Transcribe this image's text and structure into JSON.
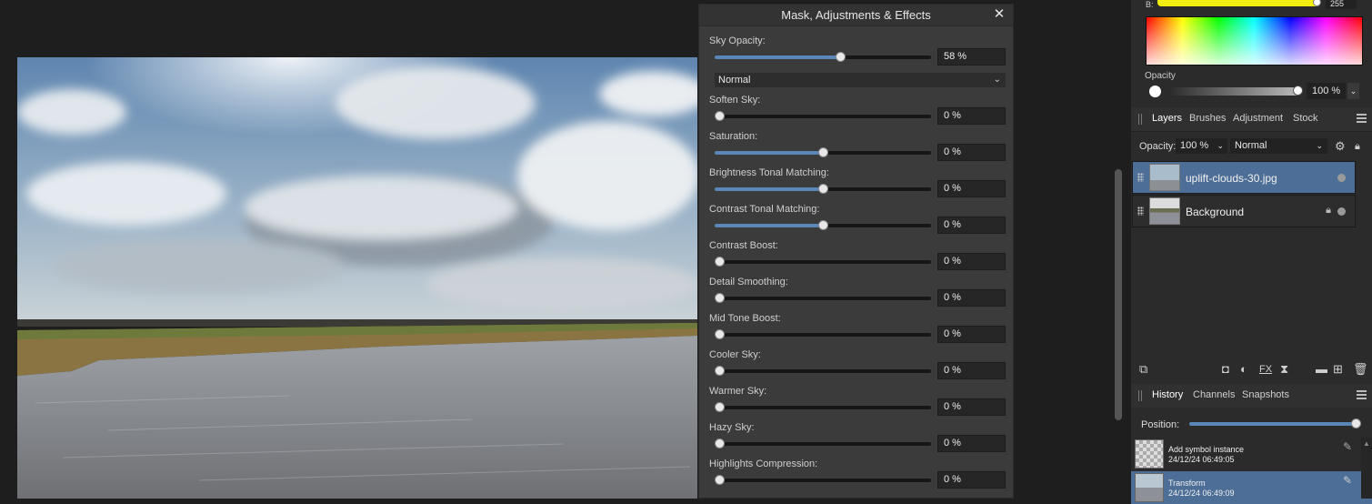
{
  "dialog": {
    "title": "Mask, Adjustments & Effects",
    "blend_mode": "Normal",
    "controls": [
      {
        "label": "Sky Opacity:",
        "value": "58 %",
        "fraction": 0.58
      },
      {
        "label": "Soften Sky:",
        "value": "0 %",
        "fraction": 0.0
      },
      {
        "label": "Saturation:",
        "value": "0 %",
        "fraction": 0.5
      },
      {
        "label": "Brightness Tonal Matching:",
        "value": "0 %",
        "fraction": 0.5
      },
      {
        "label": "Contrast Tonal Matching:",
        "value": "0 %",
        "fraction": 0.5
      },
      {
        "label": "Contrast Boost:",
        "value": "0 %",
        "fraction": 0.0
      },
      {
        "label": "Detail Smoothing:",
        "value": "0 %",
        "fraction": 0.0
      },
      {
        "label": "Mid Tone Boost:",
        "value": "0 %",
        "fraction": 0.0
      },
      {
        "label": "Cooler Sky:",
        "value": "0 %",
        "fraction": 0.0
      },
      {
        "label": "Warmer Sky:",
        "value": "0 %",
        "fraction": 0.0
      },
      {
        "label": "Hazy Sky:",
        "value": "0 %",
        "fraction": 0.0
      },
      {
        "label": "Highlights Compression:",
        "value": "0 %",
        "fraction": 0.0
      }
    ]
  },
  "color": {
    "b_label": "B:",
    "b_value": "255",
    "opacity_label": "Opacity",
    "opacity_value": "100 %"
  },
  "layers_panel": {
    "tabs": [
      "Layers",
      "Brushes",
      "Adjustment",
      "Stock"
    ],
    "opacity_label": "Opacity:",
    "opacity_value": "100 %",
    "blend_mode": "Normal",
    "layers": [
      {
        "name": "uplift-clouds-30.jpg",
        "selected": true
      },
      {
        "name": "Background",
        "selected": false
      }
    ]
  },
  "history_panel": {
    "tabs": [
      "History",
      "Channels",
      "Snapshots"
    ],
    "position_label": "Position:",
    "position_fraction": 1.0,
    "entries": [
      {
        "action": "Add symbol instance",
        "time": "24/12/24 06:49:05"
      },
      {
        "action": "Transform",
        "time": "24/12/24 06:49:09"
      }
    ]
  },
  "colors": {
    "accent": "#4d6e96",
    "slider_fill": "#5a86b8"
  }
}
